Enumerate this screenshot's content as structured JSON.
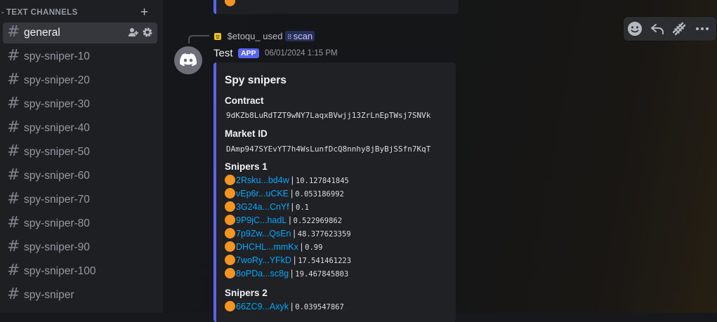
{
  "sidebar": {
    "category": {
      "chevron": "⌄",
      "label": "TEXT CHANNELS",
      "add_icon": "+"
    },
    "channels": [
      {
        "name": "general",
        "active": true
      },
      {
        "name": "spy-sniper-10"
      },
      {
        "name": "spy-sniper-20"
      },
      {
        "name": "spy-sniper-30"
      },
      {
        "name": "spy-sniper-40"
      },
      {
        "name": "spy-sniper-50"
      },
      {
        "name": "spy-sniper-60"
      },
      {
        "name": "spy-sniper-70"
      },
      {
        "name": "spy-sniper-80"
      },
      {
        "name": "spy-sniper-90"
      },
      {
        "name": "spy-sniper-100"
      },
      {
        "name": "spy-sniper"
      }
    ],
    "hash_symbol": "#",
    "active_channel_icons": [
      "add-member-icon",
      "gear-icon"
    ]
  },
  "message": {
    "reply": {
      "user": "$etoqu_",
      "action": "used",
      "command": "scan",
      "command_icon": "⠿"
    },
    "author": "Test",
    "badge": "APP",
    "timestamp": "06/01/2024 1:15 PM",
    "embed": {
      "title": "Spy snipers",
      "contract_label": "Contract",
      "contract_value": "9dKZb8LuRdTZT9wNY7LaqxBVwjj13ZrLnEpTWsj7SNVk",
      "market_label": "Market ID",
      "market_value": "DAmp947SYEvYT7h4WsLunfDcQ8nnhy8jByBjSSfn7KqT",
      "snipers1_label": "Snipers 1",
      "snipers1": [
        {
          "addr": "2Rsku...bd4w",
          "amount": "10.127841845"
        },
        {
          "addr": "vEp6r...uCKE",
          "amount": "0.053186992"
        },
        {
          "addr": "3G24a...CnYf",
          "amount": "0.1"
        },
        {
          "addr": "9P9jC...hadL",
          "amount": "0.522969862"
        },
        {
          "addr": "7p9Zw...QsEn",
          "amount": "48.377623359"
        },
        {
          "addr": "DHCHL...mmKx",
          "amount": "0.99"
        },
        {
          "addr": "7woRy...YFkD",
          "amount": "17.541461223"
        },
        {
          "addr": "8oPDa...sc8g",
          "amount": "19.467845803"
        }
      ],
      "snipers2_label": "Snipers 2",
      "snipers2": [
        {
          "addr": "66ZC9...Axyk",
          "amount": "0.039547867"
        }
      ],
      "separator": "|"
    }
  },
  "toolbar": [
    "add-reaction-icon",
    "reply-icon",
    "app-command-icon",
    "more-icon"
  ],
  "colors": {
    "accent": "#5865f2",
    "link": "#00a8fc",
    "sidebar_bg": "#1e1f22",
    "active_channel_bg": "#35373c",
    "coin": "#f7941d"
  }
}
